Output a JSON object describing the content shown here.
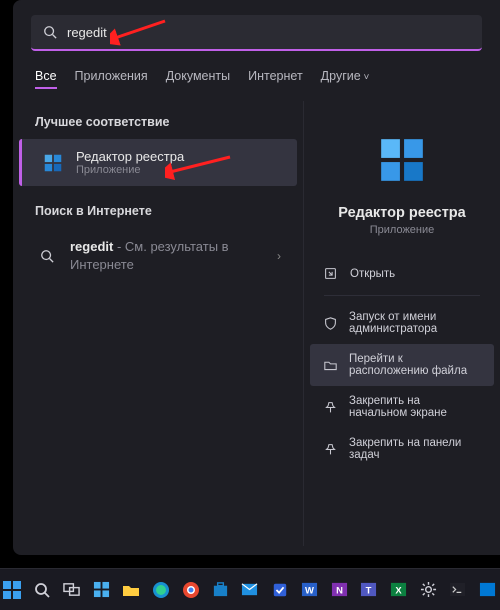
{
  "search": {
    "query": "regedit"
  },
  "tabs": [
    {
      "label": "Все",
      "active": true
    },
    {
      "label": "Приложения"
    },
    {
      "label": "Документы"
    },
    {
      "label": "Интернет"
    },
    {
      "label": "Другие",
      "dropdown": true
    }
  ],
  "sections": {
    "best_match": "Лучшее соответствие",
    "web_search": "Поиск в Интернете"
  },
  "best_match_result": {
    "title": "Редактор реестра",
    "subtitle": "Приложение"
  },
  "web_result": {
    "prefix": "regedit",
    "suffix": " - См. результаты в Интернете"
  },
  "preview": {
    "title": "Редактор реестра",
    "subtitle": "Приложение"
  },
  "actions": [
    {
      "icon": "open",
      "label": "Открыть"
    },
    {
      "icon": "shield",
      "label": "Запуск от имени администратора"
    },
    {
      "icon": "folder",
      "label": "Перейти к расположению файла",
      "highlight": true
    },
    {
      "icon": "pin",
      "label": "Закрепить на начальном экране"
    },
    {
      "icon": "pin",
      "label": "Закрепить на панели задач"
    }
  ],
  "taskbar_icons": [
    "start",
    "search",
    "taskview",
    "widgets",
    "explorer",
    "edge",
    "chrome",
    "store",
    "mail",
    "todo",
    "word",
    "onenote",
    "teams",
    "excel",
    "settings",
    "terminal",
    "vscode"
  ]
}
